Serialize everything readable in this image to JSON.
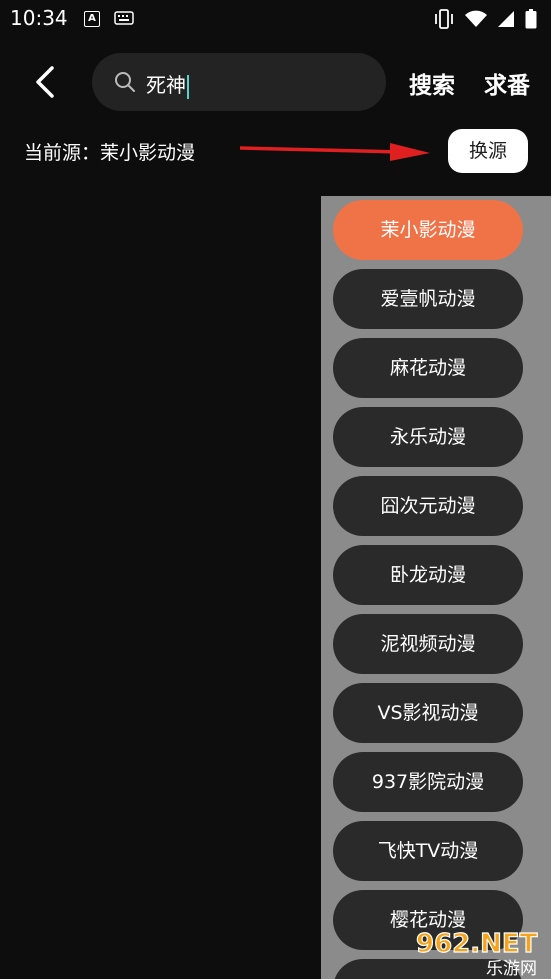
{
  "status_bar": {
    "time": "10:34",
    "icons": [
      "a-icon",
      "keyboard-icon",
      "vibrate-icon",
      "wifi-icon",
      "signal-icon",
      "battery-icon"
    ]
  },
  "header": {
    "search_query": "死神",
    "search_button": "搜索",
    "request_button": "求番"
  },
  "source": {
    "label": "当前源：茉小影动漫",
    "switch_button": "换源"
  },
  "sources": [
    {
      "label": "茉小影动漫",
      "active": true
    },
    {
      "label": "爱壹帆动漫"
    },
    {
      "label": "麻花动漫"
    },
    {
      "label": "永乐动漫"
    },
    {
      "label": "囧次元动漫"
    },
    {
      "label": "卧龙动漫"
    },
    {
      "label": "泥视频动漫"
    },
    {
      "label": "VS影视动漫"
    },
    {
      "label": "937影院动漫"
    },
    {
      "label": "飞快TV动漫"
    },
    {
      "label": "樱花动漫"
    },
    {
      "label": ""
    }
  ],
  "watermark": {
    "top": "962.NET",
    "bottom": "乐游网"
  },
  "colors": {
    "active": "#f07348",
    "panel": "#8b8b8b",
    "pill": "#2a2a2a",
    "arrow": "#e02020"
  }
}
